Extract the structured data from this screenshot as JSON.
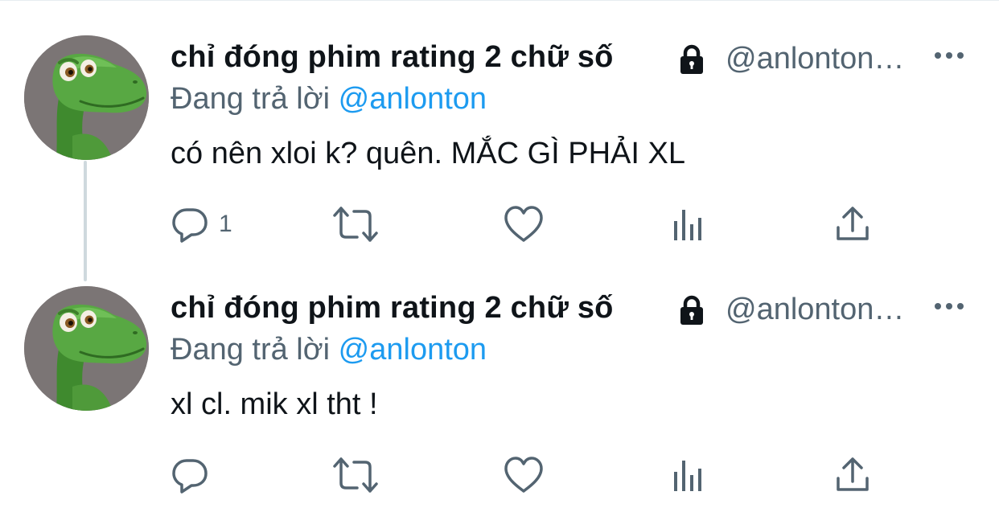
{
  "tweets": [
    {
      "display_name": "chỉ đóng phim rating 2 chữ số",
      "handle": "@anlonton…",
      "replying_label": "Đang trả lời",
      "replying_to": "@anlonton",
      "text": "có nên xloi k? quên. MẮC GÌ PHẢI XL",
      "reply_count": "1",
      "protected": true
    },
    {
      "display_name": "chỉ đóng phim rating 2 chữ số",
      "handle": "@anlonton…",
      "replying_label": "Đang trả lời",
      "replying_to": "@anlonton",
      "text": "xl cl. mik xl tht !",
      "reply_count": "",
      "protected": true
    }
  ],
  "icons": {
    "lock": "lock-icon",
    "more": "more-icon",
    "reply": "reply-icon",
    "retweet": "retweet-icon",
    "like": "heart-icon",
    "analytics": "analytics-icon",
    "share": "share-icon"
  },
  "colors": {
    "text_primary": "#0f1419",
    "text_secondary": "#536471",
    "mention": "#1d9bf0",
    "thread_line": "#cfd9de",
    "avatar_bg": "#7b7575",
    "dino_green": "#4f9a3a"
  }
}
